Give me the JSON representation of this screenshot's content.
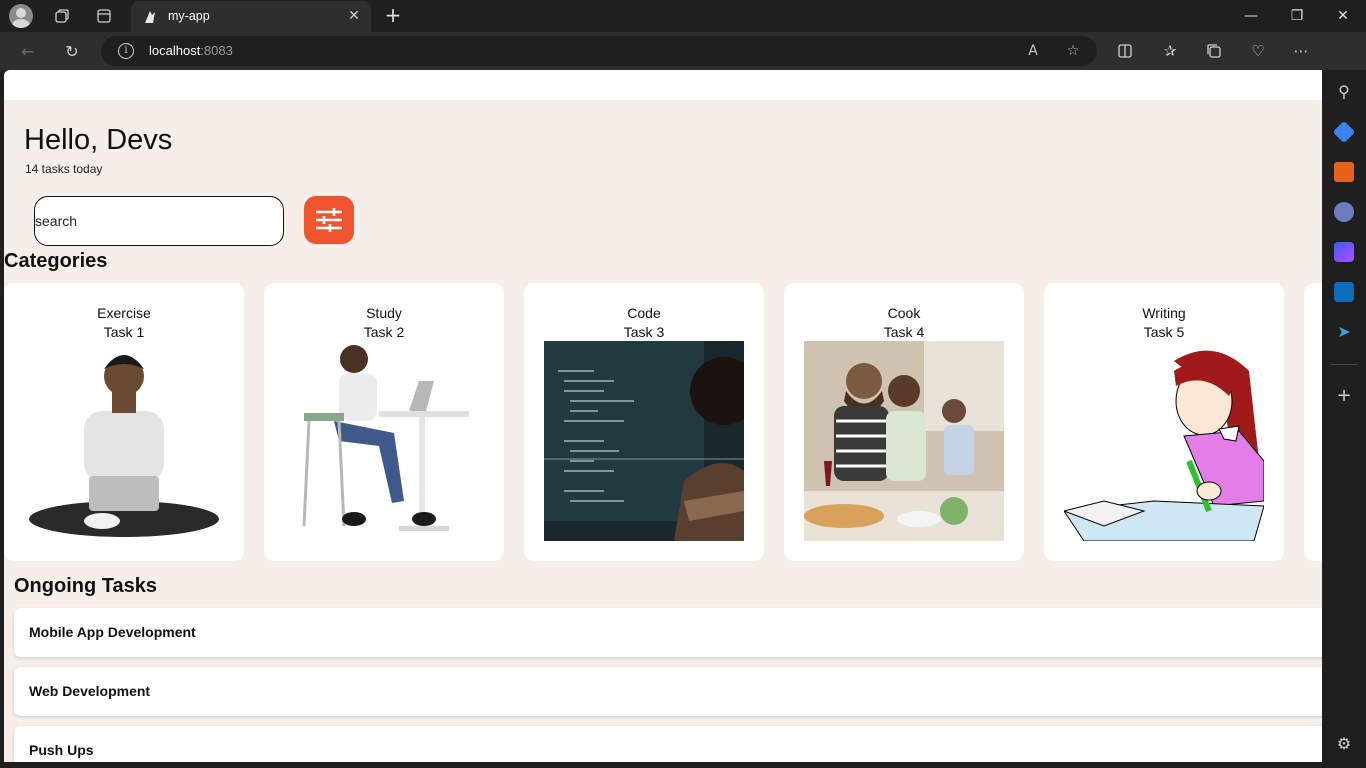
{
  "browser": {
    "tab_title": "my-app",
    "url_host": "localhost",
    "url_port": ":8083"
  },
  "page": {
    "greeting": "Hello, Devs",
    "subtitle": "14 tasks today",
    "search_placeholder": "search",
    "categories_title": "Categories",
    "ongoing_title": "Ongoing Tasks"
  },
  "categories": [
    {
      "name": "Exercise",
      "task": "Task 1",
      "image": "person-sitting-with-laptop"
    },
    {
      "name": "Study",
      "task": "Task 2",
      "image": "person-studying-at-desk"
    },
    {
      "name": "Code",
      "task": "Task 3",
      "image": "person-coding-at-monitor"
    },
    {
      "name": "Cook",
      "task": "Task 4",
      "image": "people-cooking-together"
    },
    {
      "name": "Writing",
      "task": "Task 5",
      "image": "girl-writing-in-notebook"
    }
  ],
  "ongoing_tasks": [
    {
      "label": "Mobile App Development"
    },
    {
      "label": "Web Development"
    },
    {
      "label": "Push Ups"
    }
  ],
  "colors": {
    "accent": "#f0542f",
    "page_bg": "#f6efe9"
  }
}
